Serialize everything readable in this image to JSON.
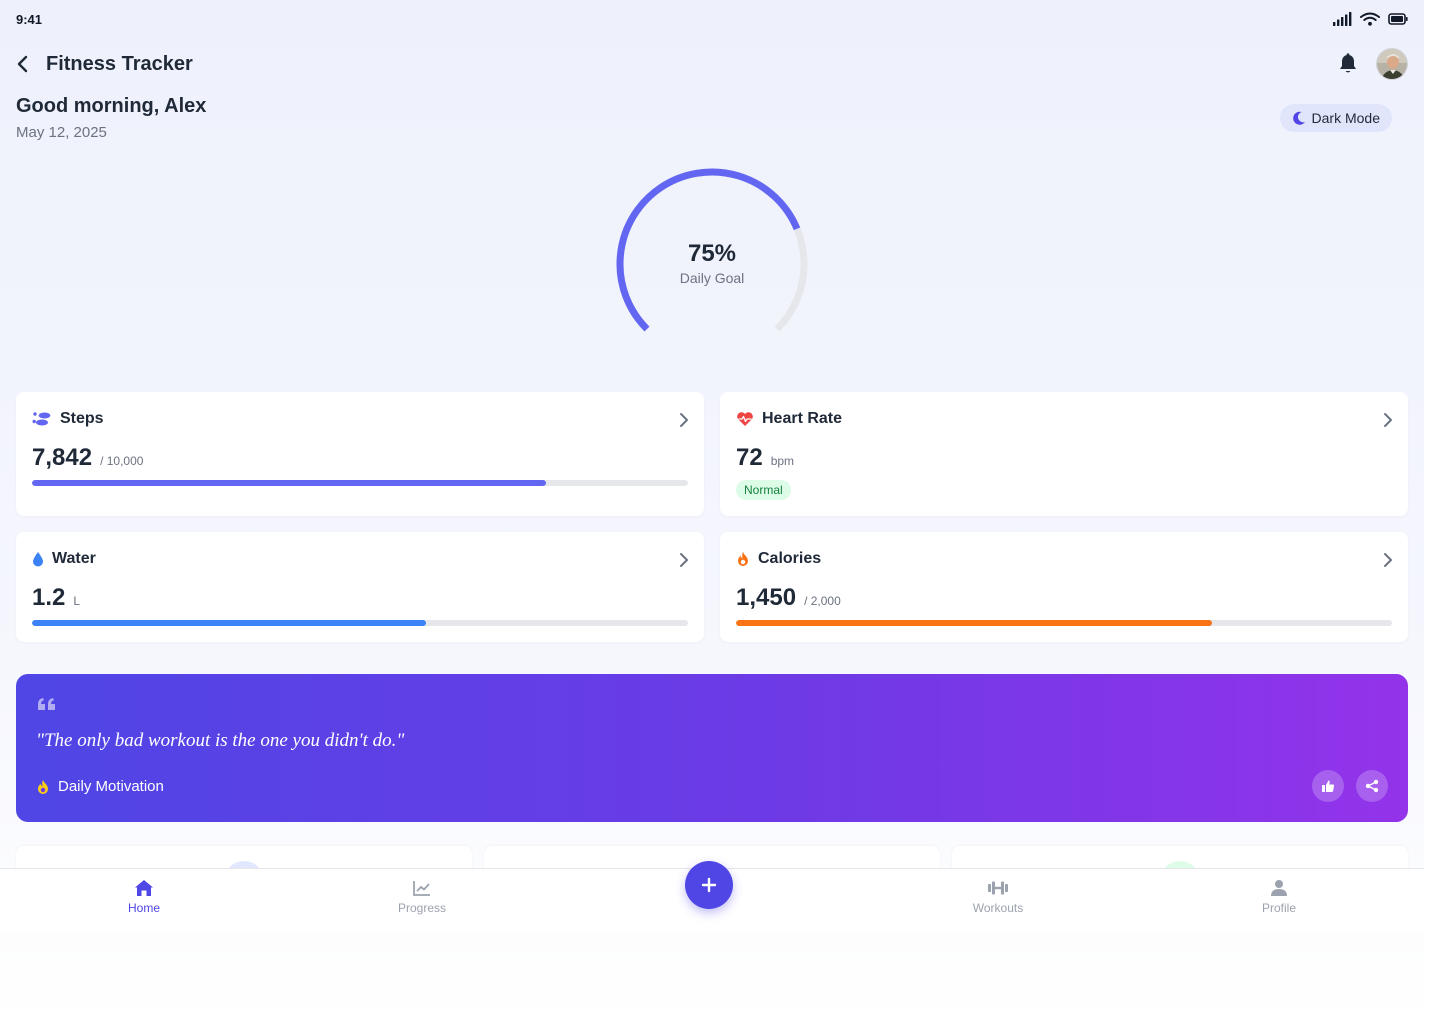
{
  "status_bar": {
    "time": "9:41",
    "icons": [
      "signal-icon",
      "wifi-icon",
      "battery-icon"
    ]
  },
  "header": {
    "title": "Fitness Tracker",
    "back_icon": "chevron-left-icon",
    "notification_icon": "bell-icon"
  },
  "greeting": {
    "title": "Good morning, Alex",
    "date": "May 12, 2025"
  },
  "dark_mode_toggle": {
    "label": "Dark Mode",
    "icon": "moon-icon"
  },
  "daily_goal": {
    "value_text": "75%",
    "label": "Daily Goal",
    "progress": 0.75
  },
  "cards": {
    "steps": {
      "title": "Steps",
      "value": "7,842",
      "unit": "/ 10,000",
      "progress": 0.7842,
      "color": "#6366f1",
      "icon": "footsteps-icon"
    },
    "heart_rate": {
      "title": "Heart Rate",
      "value": "72",
      "unit": "bpm",
      "status": "Normal",
      "color": "#ef4444",
      "icon": "heart-pulse-icon"
    },
    "water": {
      "title": "Water",
      "value": "1.2",
      "unit": "L",
      "progress": 0.6,
      "color": "#3b82f6",
      "icon": "water-drop-icon"
    },
    "calories": {
      "title": "Calories",
      "value": "1,450",
      "unit": "/ 2,000",
      "progress": 0.725,
      "color": "#f97316",
      "icon": "flame-icon"
    }
  },
  "motivation": {
    "quote": "\"The only bad workout is the one you didn't do.\"",
    "label": "Daily Motivation",
    "quote_icon": "quote-icon",
    "label_icon": "flame-icon",
    "actions": [
      "thumbs-up-icon",
      "share-icon"
    ]
  },
  "bottom_nav": {
    "items": [
      {
        "label": "Home",
        "icon": "home-icon",
        "active": true
      },
      {
        "label": "Progress",
        "icon": "chart-line-icon",
        "active": false
      },
      {
        "label": "Workouts",
        "icon": "dumbbell-icon",
        "active": false
      },
      {
        "label": "Profile",
        "icon": "user-icon",
        "active": false
      }
    ],
    "fab_icon": "plus-icon"
  },
  "colors": {
    "accent": "#4f46e5",
    "ring": "#6366f1",
    "ring_track": "#e5e7eb"
  }
}
